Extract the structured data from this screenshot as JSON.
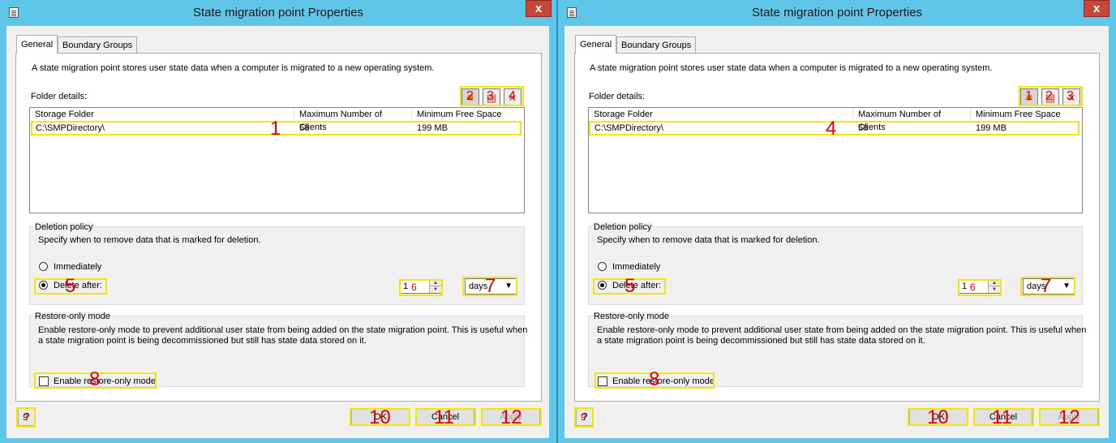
{
  "dialog": {
    "title": "State migration point Properties",
    "close_glyph": "x"
  },
  "tabs": [
    {
      "label": "General"
    },
    {
      "label": "Boundary Groups"
    }
  ],
  "general": {
    "description": "A state migration point stores user state data when a computer is migrated to a new operating system.",
    "folder_details_label": "Folder details:",
    "columns": [
      "Storage Folder",
      "Maximum Number of Clients",
      "Minimum Free Space"
    ],
    "rows": [
      {
        "folder": "C:\\SMPDirectory\\",
        "clients": "56",
        "space": "199 MB"
      }
    ]
  },
  "deletion_policy": {
    "legend": "Deletion policy",
    "description": "Specify when to remove data that is marked for deletion.",
    "immediately_label": "Immediately",
    "delete_after_label": "Delete after:",
    "value": "1",
    "unit": "days"
  },
  "restore_only": {
    "legend": "Restore-only mode",
    "description_line1": "Enable restore-only mode to prevent additional user state from being added on the state migration point.  This is useful when",
    "description_line2": "a state migration point is being decommissioned but still has state data stored on it.",
    "checkbox_label": "Enable restore-only mode"
  },
  "buttons": {
    "ok": "OK",
    "cancel": "Cancel",
    "apply": "Apply"
  },
  "annotations": {
    "left": {
      "icons": [
        "2",
        "3",
        "4"
      ],
      "row": "1",
      "delete_after": "5",
      "spin": "6",
      "combo": "7",
      "checkbox": "8",
      "help": "9",
      "ok": "10",
      "cancel": "11",
      "apply": "12"
    },
    "right": {
      "icons": [
        "1",
        "2",
        "3"
      ],
      "row": "4",
      "delete_after": "5",
      "spin": "6",
      "combo": "7",
      "checkbox": "8",
      "help": "9",
      "ok": "10",
      "cancel": "11",
      "apply": "12"
    }
  },
  "colors": {
    "window_frame": "#5fc6ea",
    "close_button": "#c7453b",
    "highlight": "#f5e600",
    "annotation": "#e00000"
  },
  "icon_names": [
    "new-folder-icon",
    "properties-icon",
    "delete-icon",
    "help-icon"
  ]
}
